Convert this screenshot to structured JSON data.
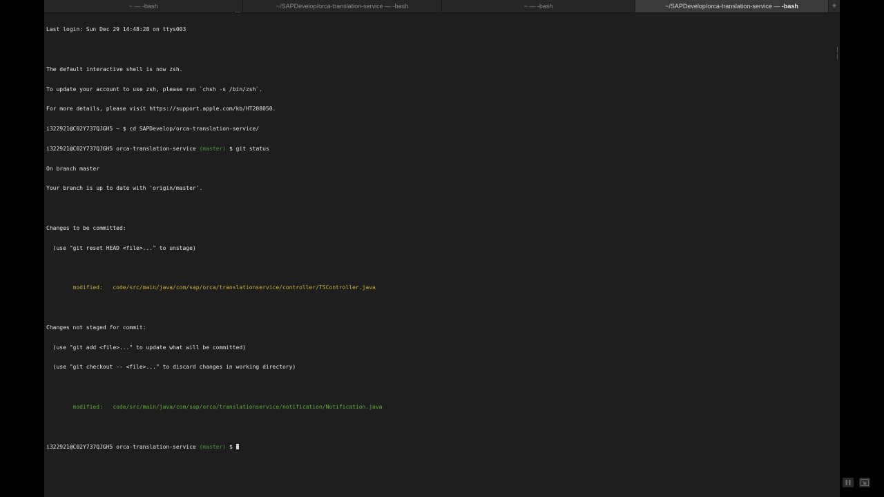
{
  "tabs": [
    {
      "label": "~ — -bash",
      "ellipsis": "..."
    },
    {
      "label": "~/SAPDevelop/orca-translation-service — -bash"
    },
    {
      "label": "~ — -bash"
    },
    {
      "label_prefix": "~/SAPDevelop/orca-translation-service — ",
      "label_bold": "-bash"
    }
  ],
  "add_tab_label": "+",
  "terminal": {
    "last_login": "Last login: Sun Dec 29 14:48:28 on ttys003",
    "shell_notice_1": "The default interactive shell is now zsh.",
    "shell_notice_2": "To update your account to use zsh, please run `chsh -s /bin/zsh`.",
    "shell_notice_3": "For more details, please visit https://support.apple.com/kb/HT208050.",
    "cmd_cd": "i322921@C02Y737QJGH5 ~ $ cd SAPDevelop/orca-translation-service/",
    "prompt_user": "i322921@C02Y737QJGH5 orca-translation-service",
    "prompt_branch": "(master)",
    "prompt_symbol": "$",
    "cmd_git_status": "git status",
    "on_branch": "On branch master",
    "up_to_date": "Your branch is up to date with 'origin/master'.",
    "staged_header": "Changes to be committed:",
    "staged_hint": "  (use \"git reset HEAD <file>...\" to unstage)",
    "staged_file": "        modified:   code/src/main/java/com/sap/orca/translationservice/controller/TSController.java",
    "unstaged_header": "Changes not staged for commit:",
    "unstaged_hint_1": "  (use \"git add <file>...\" to update what will be committed)",
    "unstaged_hint_2": "  (use \"git checkout -- <file>...\" to discard changes in working directory)",
    "unstaged_file": "        modified:   code/src/main/java/com/sap/orca/translationservice/notification/Notification.java"
  },
  "icons": {
    "pause": "pause-icon",
    "picture_in_picture": "picture-in-picture-icon"
  },
  "colors": {
    "background": "#1e1e1e",
    "text": "#e6e6e6",
    "branch": "#4a9a43",
    "staged": "#c8b23a",
    "unstaged": "#5fae3a"
  }
}
